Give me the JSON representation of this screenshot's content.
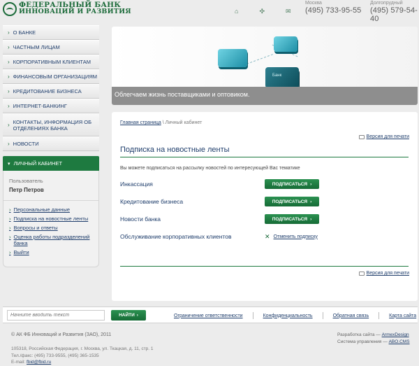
{
  "header": {
    "logo_line1": "ФЕДЕРАЛЬНЫЙ БАНК",
    "logo_line2": "ИННОВАЦИЙ И РАЗВИТИЯ",
    "icons": [
      "home-icon",
      "sitemap-icon",
      "mail-icon"
    ],
    "phones": [
      {
        "city": "Москва",
        "number": "(495) 733-95-55"
      },
      {
        "city": "Долгопрудный",
        "number": "(495) 579-54-40"
      }
    ]
  },
  "sidebar": {
    "menu": [
      {
        "label": "О БАНКЕ"
      },
      {
        "label": "ЧАСТНЫМ ЛИЦАМ"
      },
      {
        "label": "КОРПОРАТИВНЫМ КЛИЕНТАМ"
      },
      {
        "label": "ФИНАНСОВЫМ ОРГАНИЗАЦИЯМ"
      },
      {
        "label": "КРЕДИТОВАНИЕ БИЗНЕСА"
      },
      {
        "label": "ИНТЕРНЕТ-БАНКИНГ"
      },
      {
        "label": "КОНТАКТЫ, ИНФОРМАЦИЯ ОБ ОТДЕЛЕНИЯХ БАНКА"
      },
      {
        "label": "НОВОСТИ"
      }
    ],
    "cabinet": {
      "title": "ЛИЧНЫЙ КАБИНЕТ",
      "user_label": "Пользователь",
      "user_name": "Петр Петров",
      "links": [
        {
          "label": "Персональные данные"
        },
        {
          "label": "Подписка на новостные ленты"
        },
        {
          "label": "Вопросы и ответы"
        },
        {
          "label": "Оценка работы подразделений банка"
        },
        {
          "label": "Выйти"
        }
      ]
    }
  },
  "banner": {
    "caption": "Облегчаем жизнь поставщиками и оптовиком.",
    "key_label": "Банк"
  },
  "main": {
    "breadcrumb_home": "Главная страница",
    "breadcrumb_sep": "\\",
    "breadcrumb_current": "Личный кабинет",
    "print_label": "Версия для печати",
    "title": "Подписка на новостные ленты",
    "description": "Вы можете подписаться на рассылку новостей по интересующей Вас тематике",
    "subscribe_label": "ПОДПИСАТЬСЯ",
    "unsubscribe_label": "Отменить подписку",
    "subscriptions": [
      {
        "label": "Инкассация",
        "subscribed": false
      },
      {
        "label": "Кредитование бизнеса",
        "subscribed": false
      },
      {
        "label": "Новости банка",
        "subscribed": false
      },
      {
        "label": "Обслуживание корпоративных клиентов",
        "subscribed": true
      }
    ]
  },
  "bottom_bar": {
    "search_placeholder": "Начните вводить текст",
    "search_button": "НАЙТИ",
    "links": [
      {
        "label": "Ограничение ответственности"
      },
      {
        "label": "Конфиденциальность"
      },
      {
        "label": "Обратная связь"
      },
      {
        "label": "Карта сайта"
      }
    ]
  },
  "footer": {
    "copyright": "© АК ФБ Инноваций и Развития (ЗАО), 2011",
    "address": "105318, Российская Федерация, г. Москва, ул. Ткацкая, д. 11, стр. 1",
    "phones": "Тел./факс: (495) 733-9555, (495) 365-1535",
    "email_label": "E-mail:",
    "email": "fbid@fbid.ru",
    "dev_label": "Разработка сайта —",
    "dev_name": "ArmexDesign",
    "cms_label": "Система управления —",
    "cms_name": "ABO.CMS"
  },
  "colors": {
    "accent_green": "#1e7a40",
    "link_blue": "#1e3d6b",
    "banner_strip": "#8e8e8e"
  }
}
